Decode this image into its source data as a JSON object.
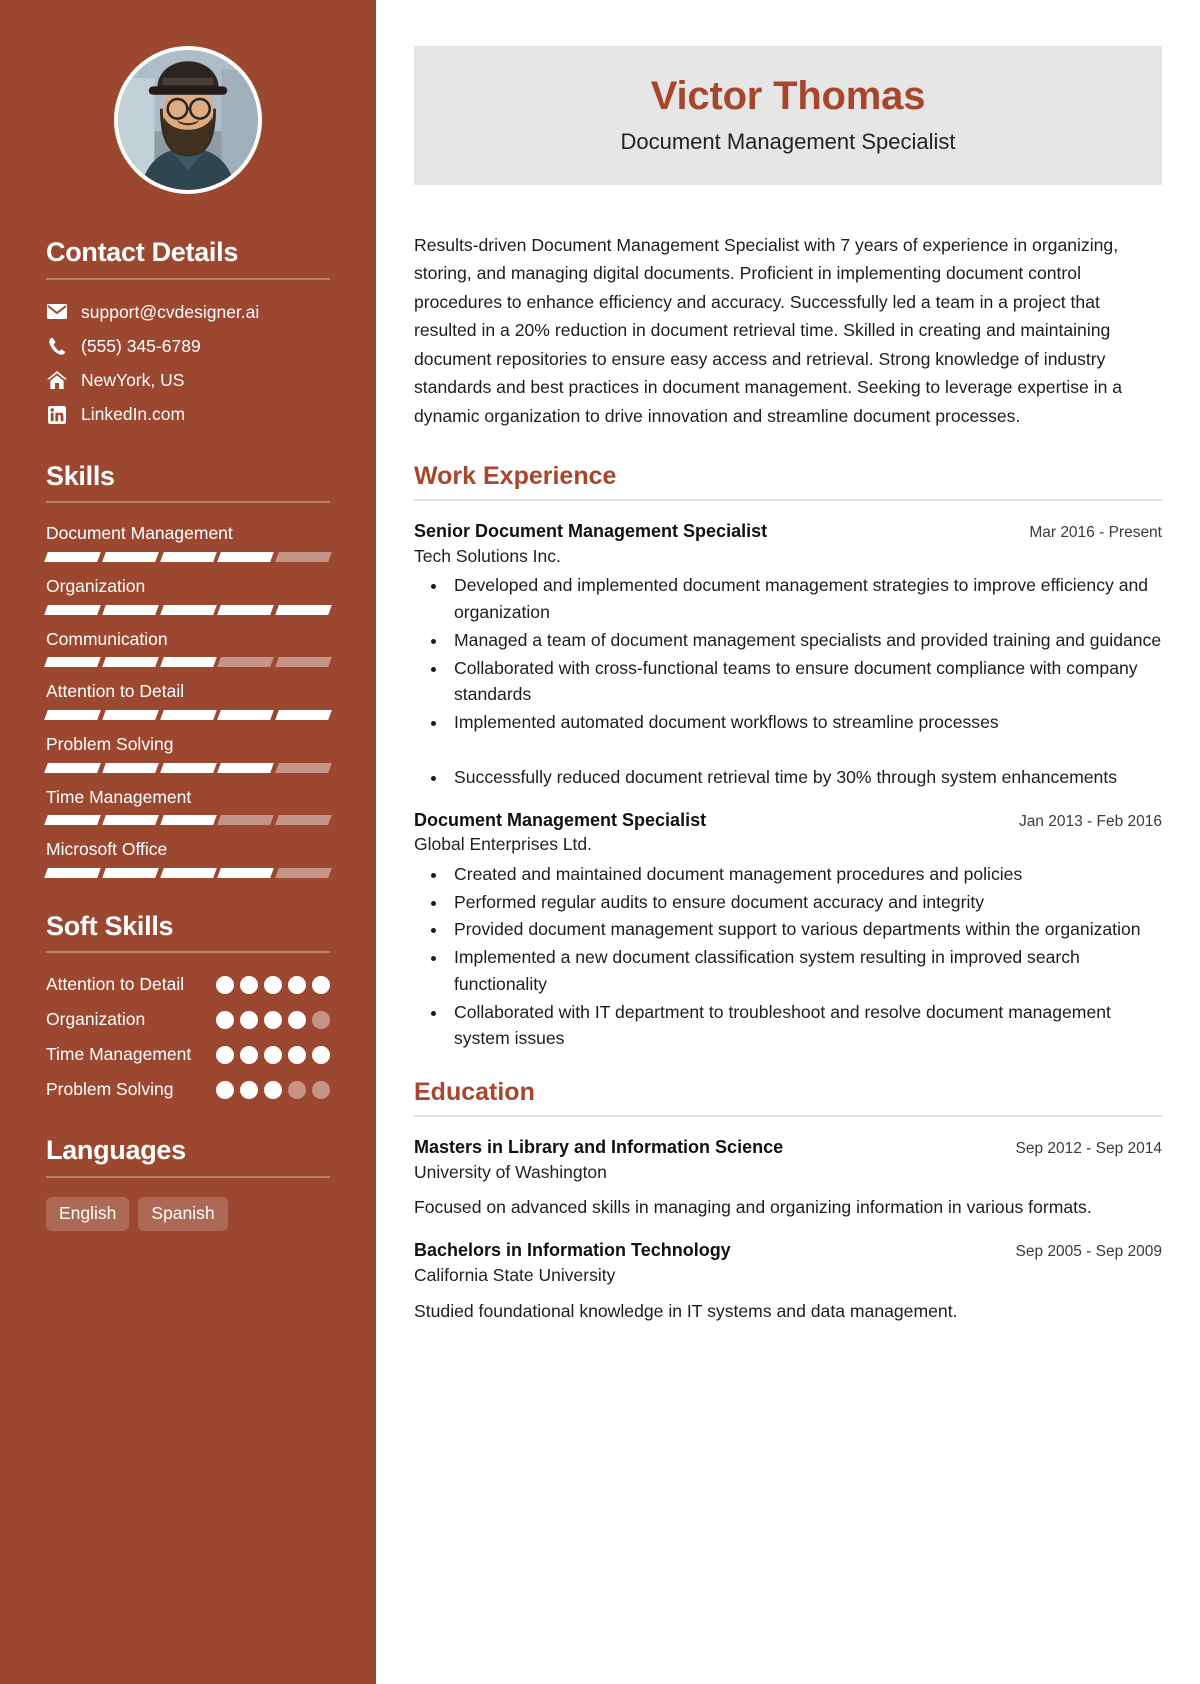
{
  "theme": {
    "sidebar_bg": "#9c4830",
    "accent": "#a8462c",
    "namecard_bg": "#e6e6e6"
  },
  "header": {
    "name": "Victor Thomas",
    "role": "Document Management Specialist"
  },
  "summary": "Results-driven Document Management Specialist with 7 years of experience in organizing, storing, and managing digital documents. Proficient in implementing document control procedures to enhance efficiency and accuracy. Successfully led a team in a project that resulted in a 20% reduction in document retrieval time. Skilled in creating and maintaining document repositories to ensure easy access and retrieval. Strong knowledge of industry standards and best practices in document management. Seeking to leverage expertise in a dynamic organization to drive innovation and streamline document processes.",
  "sidebar": {
    "contact": {
      "heading": "Contact Details",
      "items": [
        {
          "icon": "email-icon",
          "value": "support@cvdesigner.ai"
        },
        {
          "icon": "phone-icon",
          "value": "(555) 345-6789"
        },
        {
          "icon": "home-icon",
          "value": "NewYork, US"
        },
        {
          "icon": "linkedin-icon",
          "value": "LinkedIn.com"
        }
      ]
    },
    "skills": {
      "heading": "Skills",
      "max": 5,
      "items": [
        {
          "name": "Document Management",
          "level": 4
        },
        {
          "name": "Organization",
          "level": 5
        },
        {
          "name": "Communication",
          "level": 3
        },
        {
          "name": "Attention to Detail",
          "level": 5
        },
        {
          "name": "Problem Solving",
          "level": 4
        },
        {
          "name": "Time Management",
          "level": 3
        },
        {
          "name": "Microsoft Office",
          "level": 4
        }
      ]
    },
    "soft_skills": {
      "heading": "Soft Skills",
      "max": 5,
      "items": [
        {
          "name": "Attention to Detail",
          "level": 5
        },
        {
          "name": "Organization",
          "level": 4
        },
        {
          "name": "Time Management",
          "level": 5
        },
        {
          "name": "Problem Solving",
          "level": 3
        }
      ]
    },
    "languages": {
      "heading": "Languages",
      "items": [
        "English",
        "Spanish"
      ]
    }
  },
  "main": {
    "work": {
      "heading": "Work Experience",
      "entries": [
        {
          "title": "Senior Document Management Specialist",
          "date": "Mar 2016 - Present",
          "org": "Tech Solutions Inc.",
          "bullets": [
            "Developed and implemented document management strategies to improve efficiency and organization",
            "Managed a team of document management specialists and provided training and guidance",
            "Collaborated with cross-functional teams to ensure document compliance with company standards",
            "Implemented automated document workflows to streamline processes",
            "Successfully reduced document retrieval time by 30% through system enhancements"
          ],
          "gap_before_index": 4
        },
        {
          "title": "Document Management Specialist",
          "date": "Jan 2013 - Feb 2016",
          "org": "Global Enterprises Ltd.",
          "bullets": [
            "Created and maintained document management procedures and policies",
            "Performed regular audits to ensure document accuracy and integrity",
            "Provided document management support to various departments within the organization",
            "Implemented a new document classification system resulting in improved search functionality",
            "Collaborated with IT department to troubleshoot and resolve document management system issues"
          ]
        }
      ]
    },
    "education": {
      "heading": "Education",
      "entries": [
        {
          "title": "Masters in Library and Information Science",
          "date": "Sep 2012 - Sep 2014",
          "org": "University of Washington",
          "desc": "Focused on advanced skills in managing and organizing information in various formats."
        },
        {
          "title": "Bachelors in Information Technology",
          "date": "Sep 2005 - Sep 2009",
          "org": "California State University",
          "desc": "Studied foundational knowledge in IT systems and data management."
        }
      ]
    }
  }
}
